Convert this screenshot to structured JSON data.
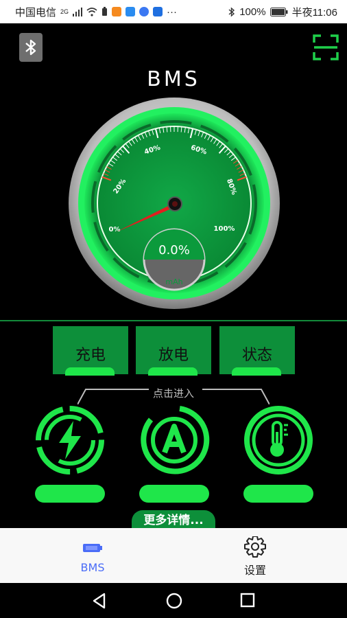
{
  "status_bar": {
    "carrier": "中国电信",
    "network": "2G",
    "overflow": "···",
    "battery": "100%",
    "time": "半夜11:06"
  },
  "header": {
    "title": "BMS"
  },
  "gauge": {
    "ticks": [
      "0%",
      "20%",
      "40%",
      "60%",
      "80%",
      "100%"
    ],
    "percent_text": "0.0%",
    "unit": "mAh",
    "value_percent": 0
  },
  "modes": [
    {
      "label": "充电"
    },
    {
      "label": "放电"
    },
    {
      "label": "状态"
    }
  ],
  "hint": "点击进入",
  "indicators": [
    {
      "icon": "lightning-icon"
    },
    {
      "icon": "ampere-icon"
    },
    {
      "icon": "thermometer-icon"
    }
  ],
  "more_button": "更多详情...",
  "tabbar": {
    "tabs": [
      {
        "label": "BMS",
        "icon": "battery-icon",
        "active": true
      },
      {
        "label": "设置",
        "icon": "gear-icon",
        "active": false
      }
    ]
  },
  "colors": {
    "accent": "#1fe64a",
    "dark_green": "#0d8f3a",
    "tab_active": "#4a6cf7"
  }
}
